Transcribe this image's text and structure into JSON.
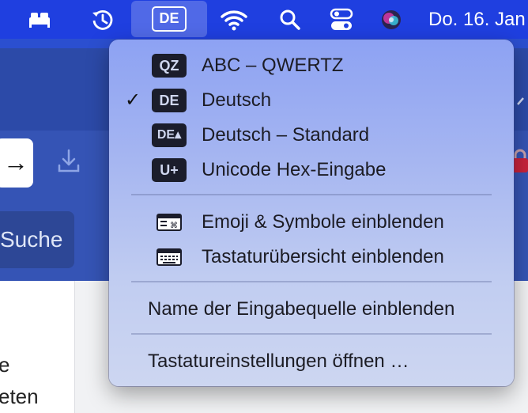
{
  "menubar": {
    "input_source_badge": "DE",
    "clock": "Do. 16. Jan",
    "icons": [
      "bed-icon",
      "time-machine-icon",
      "wifi-icon",
      "spotlight-search-icon",
      "control-center-icon",
      "siri-icon"
    ]
  },
  "background": {
    "search_button": "Suche",
    "fragment_1": "e",
    "fragment_2": "eten"
  },
  "input_menu": {
    "sources": [
      {
        "badge": "QZ",
        "label": "ABC – QWERTZ",
        "selected": false
      },
      {
        "badge": "DE",
        "label": "Deutsch",
        "selected": true
      },
      {
        "badge": "DE▴",
        "label": "Deutsch – Standard",
        "selected": false
      },
      {
        "badge": "U+",
        "label": "Unicode Hex-Eingabe",
        "selected": false
      }
    ],
    "check_mark": "✓",
    "emoji_label": "Emoji & Symbole einblenden",
    "keyboard_viewer_label": "Tastaturübersicht einblenden",
    "show_name_label": "Name der Eingabequelle einblenden",
    "settings_label": "Tastatureinstellungen öffnen …"
  },
  "colors": {
    "menubar": "#1f3fe0",
    "menu_top": "#8da2f3",
    "menu_bottom": "#cdd6f1",
    "badge_bg": "#1b1d2b"
  }
}
